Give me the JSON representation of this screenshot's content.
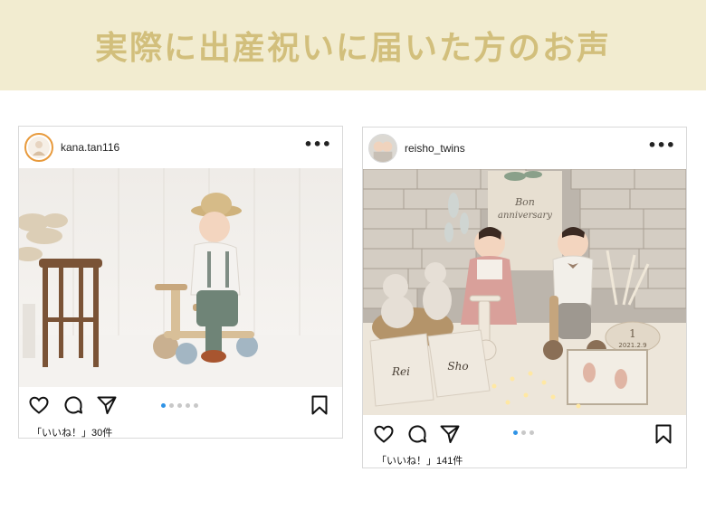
{
  "banner": {
    "title": "実際に出産祝いに届いた方のお声"
  },
  "posts": [
    {
      "username": "kana.tan116",
      "more": "•••",
      "likes_text": "「いいね！」30件",
      "carousel": {
        "count": 5,
        "active": 0
      },
      "icons": [
        "heart-icon",
        "comment-icon",
        "share-icon",
        "bookmark-icon"
      ]
    },
    {
      "username": "reisho_twins",
      "more": "•••",
      "likes_text": "「いいね！」141件",
      "carousel": {
        "count": 3,
        "active": 0
      },
      "icons": [
        "heart-icon",
        "comment-icon",
        "share-icon",
        "bookmark-icon"
      ],
      "photo_texts": {
        "banner_line1": "Bon",
        "banner_line2": "anniversary",
        "bag_left": "Rei",
        "bag_right": "Sho",
        "pillow": "1",
        "pillow_date": "2021.2.9"
      }
    }
  ],
  "colors": {
    "banner_bg": "#f2ecd0",
    "banner_text": "#d2bf7c",
    "dot_active": "#2f93e6"
  }
}
